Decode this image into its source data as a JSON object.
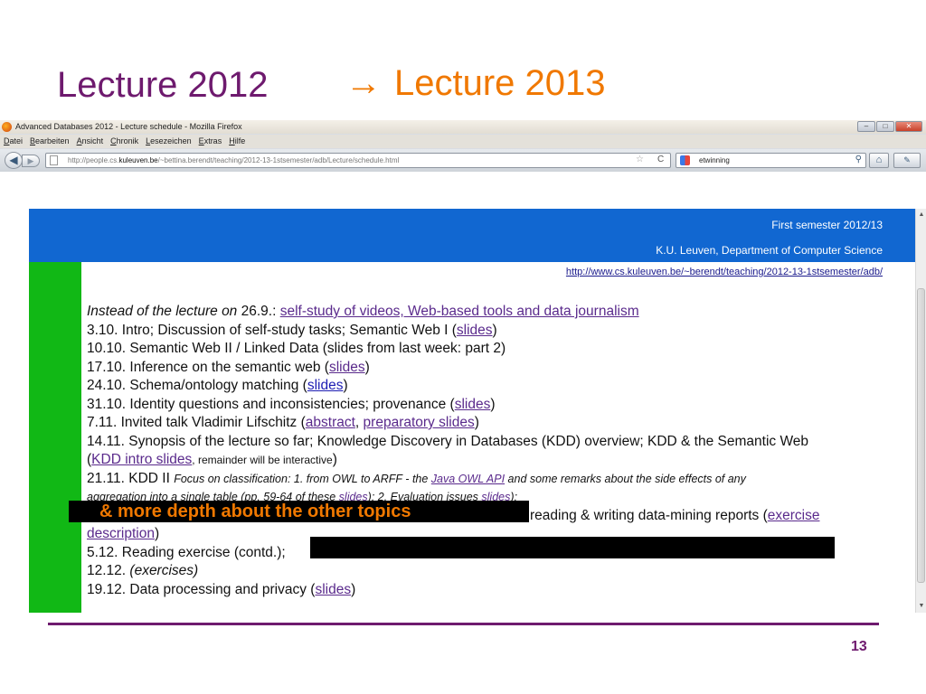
{
  "slide": {
    "title_left": "Lecture 2012",
    "title_arrow": "→",
    "title_right": "Lecture 2013",
    "overlay_text": "& more depth about the other topics",
    "page_number": "13",
    "colors": {
      "purple": "#6e1a6e",
      "orange": "#f07800",
      "header_blue": "#1167d1",
      "green_bar": "#11b815"
    }
  },
  "browser": {
    "window_title": "Advanced Databases 2012 - Lecture schedule - Mozilla Firefox",
    "window_buttons": {
      "minimize": "–",
      "maximize": "□",
      "close": "✕"
    },
    "menu": [
      "Datei",
      "Bearbeiten",
      "Ansicht",
      "Chronik",
      "Lesezeichen",
      "Extras",
      "Hilfe"
    ],
    "url_prefix": "http://people.cs.",
    "url_domain": "kuleuven.be",
    "url_suffix": "/~bettina.berendt/teaching/2012-13-1stsemester/adb/Lecture/schedule.html",
    "search_value": "etwinning",
    "icons": {
      "back": "◀",
      "forward": "▶",
      "star": "☆",
      "reload": "C",
      "search": "⚲",
      "home": "⌂",
      "bookmark": "✎"
    }
  },
  "page": {
    "header_line1": "First semester 2012/13",
    "header_line2": "K.U. Leuven, Department of Computer Science",
    "course_url": "http://www.cs.kuleuven.be/~berendt/teaching/2012-13-1stsemester/adb/",
    "schedule": {
      "l1_italic": "Instead of the lecture on",
      "l1_date": " 26.9.: ",
      "l1_link": "self-study of videos, Web-based tools and data journalism",
      "l2_text": "3.10. Intro; Discussion of self-study tasks; Semantic Web I (",
      "l2_link": "slides",
      "l2_end": ")",
      "l3_text": "10.10. Semantic Web II / Linked Data (slides from last week: part 2)",
      "l4_text": "17.10. Inference on the semantic web (",
      "l4_link": "slides",
      "l4_end": ")",
      "l5_text": "24.10. Schema/ontology matching (",
      "l5_link": "slides",
      "l5_end": ")",
      "l6_text": "31.10. Identity questions and inconsistencies; provenance (",
      "l6_link": "slides",
      "l6_end": ")",
      "l7_text": "7.11. Invited talk Vladimir Lifschitz (",
      "l7_link1": "abstract",
      "l7_sep": ", ",
      "l7_link2": "preparatory slides",
      "l7_end": ")",
      "l8_text": "14.11. Synopsis of the lecture so far; Knowledge Discovery in Databases (KDD) overview; KDD & the Semantic Web",
      "l9_open": "(",
      "l9_link": "KDD intro slides",
      "l9_small": ", remainder will be interactive",
      "l9_end": ")",
      "l10_text": "21.11. KDD II ",
      "l10_note": "Focus on classification: 1. from OWL to ARFF - the ",
      "l10_link": "Java OWL API",
      "l10_note2": " and some remarks about the side effects of any",
      "l11_note": "aggregation into a single table (pp. 59-64 of these ",
      "l11_link1": "slides",
      "l11_note2": "); 2. Evaluation issues ",
      "l11_link2": "slides",
      "l11_end": ");",
      "l12_text": "reading & writing data-mining reports (",
      "l12_link": "exercise",
      "l13_link": "description",
      "l13_end": ")",
      "l14_text": "5.12. Reading exercise (contd.);",
      "l15_text": "12.12. ",
      "l15_italic": "(exercises)",
      "l16_text": "19.12. Data processing and privacy (",
      "l16_link": "slides",
      "l16_end": ")"
    }
  },
  "scrollbar": {
    "up": "▲",
    "down": "▼"
  }
}
